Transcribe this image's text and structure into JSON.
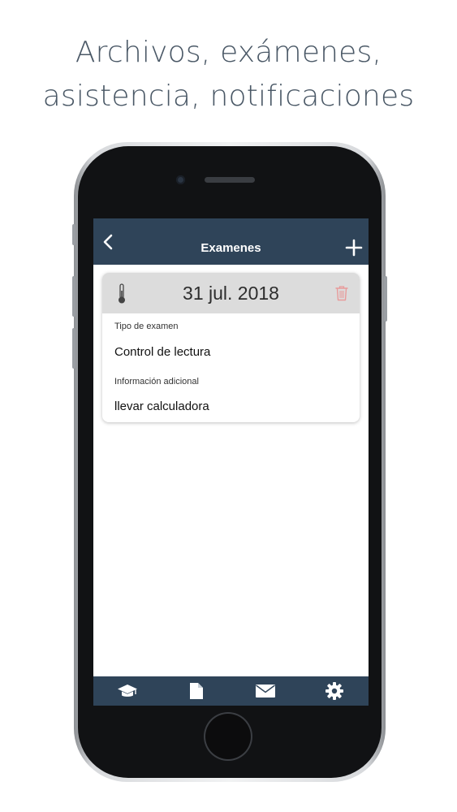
{
  "headline": {
    "line1": "Archivos, exámenes,",
    "line2": "asistencia, notificaciones"
  },
  "navbar": {
    "title": "Examenes",
    "back_icon": "chevron-left-icon",
    "add_icon": "plus-icon"
  },
  "exam_card": {
    "date": "31 jul. 2018",
    "icon": "thermometer-icon",
    "delete_icon": "trash-icon",
    "fields": [
      {
        "label": "Tipo de examen",
        "value": "Control de lectura"
      },
      {
        "label": "Información adicional",
        "value": "llevar calculadora"
      }
    ]
  },
  "tabbar": {
    "tabs": [
      {
        "icon": "graduation-cap-icon"
      },
      {
        "icon": "document-icon"
      },
      {
        "icon": "envelope-icon"
      },
      {
        "icon": "gear-icon"
      }
    ]
  },
  "colors": {
    "bar": "#2f4459",
    "card_header": "#dcdcdc",
    "headline_text": "#4a5866",
    "delete": "#e89a9a"
  }
}
